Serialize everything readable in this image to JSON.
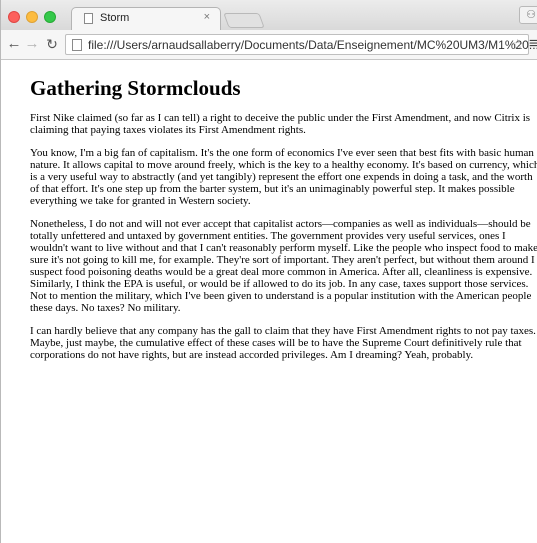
{
  "browser": {
    "tab": {
      "title": "Storm",
      "close_glyph": "×"
    },
    "url": "file:///Users/arnaudsallaberry/Documents/Data/Enseignement/MC%20UM3/M1%20...",
    "icons": {
      "back": "back-arrow-icon",
      "forward": "forward-arrow-icon",
      "reload": "reload-icon",
      "page": "page-icon",
      "bookmark": "star-icon",
      "menu": "hamburger-menu-icon"
    }
  },
  "page": {
    "heading": "Gathering Stormclouds",
    "paragraphs": [
      "First Nike claimed (so far as I can tell) a right to deceive the public under the First Amendment, and now Citrix is claiming that paying taxes violates its First Amendment rights.",
      "You know, I'm a big fan of capitalism. It's the one form of economics I've ever seen that best fits with basic human nature. It allows capital to move around freely, which is the key to a healthy economy. It's based on currency, which is a very useful way to abstractly (and yet tangibly) represent the effort one expends in doing a task, and the worth of that effort. It's one step up from the barter system, but it's an unimaginably powerful step. It makes possible everything we take for granted in Western society.",
      "Nonetheless, I do not and will not ever accept that capitalist actors—companies as well as individuals—should be totally unfettered and untaxed by government entities. The government provides very useful services, ones I wouldn't want to live without and that I can't reasonably perform myself. Like the people who inspect food to make sure it's not going to kill me, for example. They're sort of important. They aren't perfect, but without them around I suspect food poisoning deaths would be a great deal more common in America. After all, cleanliness is expensive. Similarly, I think the EPA is useful, or would be if allowed to do its job. In any case, taxes support those services. Not to mention the military, which I've been given to understand is a popular institution with the American people these days. No taxes? No military.",
      "I can hardly believe that any company has the gall to claim that they have First Amendment rights to not pay taxes. Maybe, just maybe, the cumulative effect of these cases will be to have the Supreme Court definitively rule that corporations do not have rights, but are instead accorded privileges. Am I dreaming? Yeah, probably."
    ]
  }
}
